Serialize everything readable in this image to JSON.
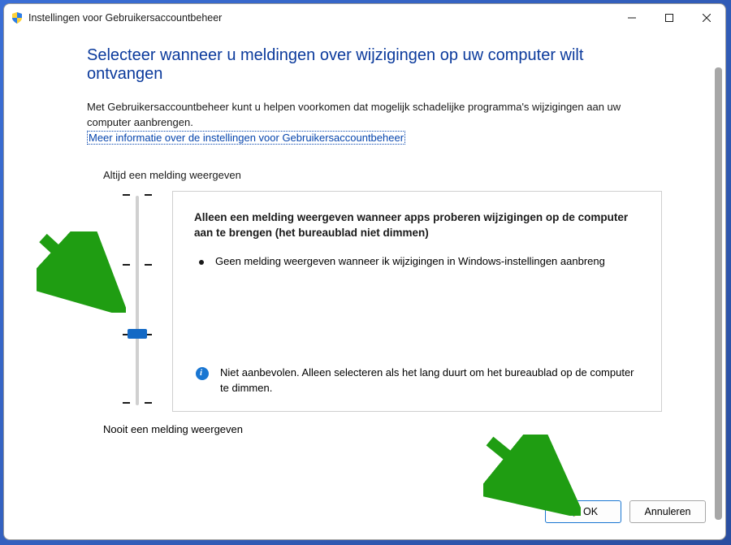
{
  "window": {
    "title": "Instellingen voor Gebruikersaccountbeheer"
  },
  "content": {
    "heading": "Selecteer wanneer u meldingen over wijzigingen op uw computer wilt ontvangen",
    "description": "Met Gebruikersaccountbeheer kunt u helpen voorkomen dat mogelijk schadelijke programma's wijzigingen aan uw computer aanbrengen.",
    "link_text": "Meer informatie over de instellingen voor Gebruikersaccountbeheer"
  },
  "slider": {
    "label_top": "Altijd een melding weergeven",
    "label_bottom": "Nooit een melding weergeven",
    "selected_index": 2,
    "levels_count": 4
  },
  "info_panel": {
    "title": "Alleen een melding weergeven wanneer apps proberen wijzigingen op de computer aan te brengen (het bureaublad niet dimmen)",
    "bullet": "Geen melding weergeven wanneer ik wijzigingen in Windows-instellingen aanbreng",
    "warning": "Niet aanbevolen. Alleen selecteren als het lang duurt om het bureaublad op de computer te dimmen."
  },
  "buttons": {
    "ok": "OK",
    "cancel": "Annuleren"
  },
  "icons": {
    "shield": "shield-icon",
    "info": "info-icon"
  }
}
